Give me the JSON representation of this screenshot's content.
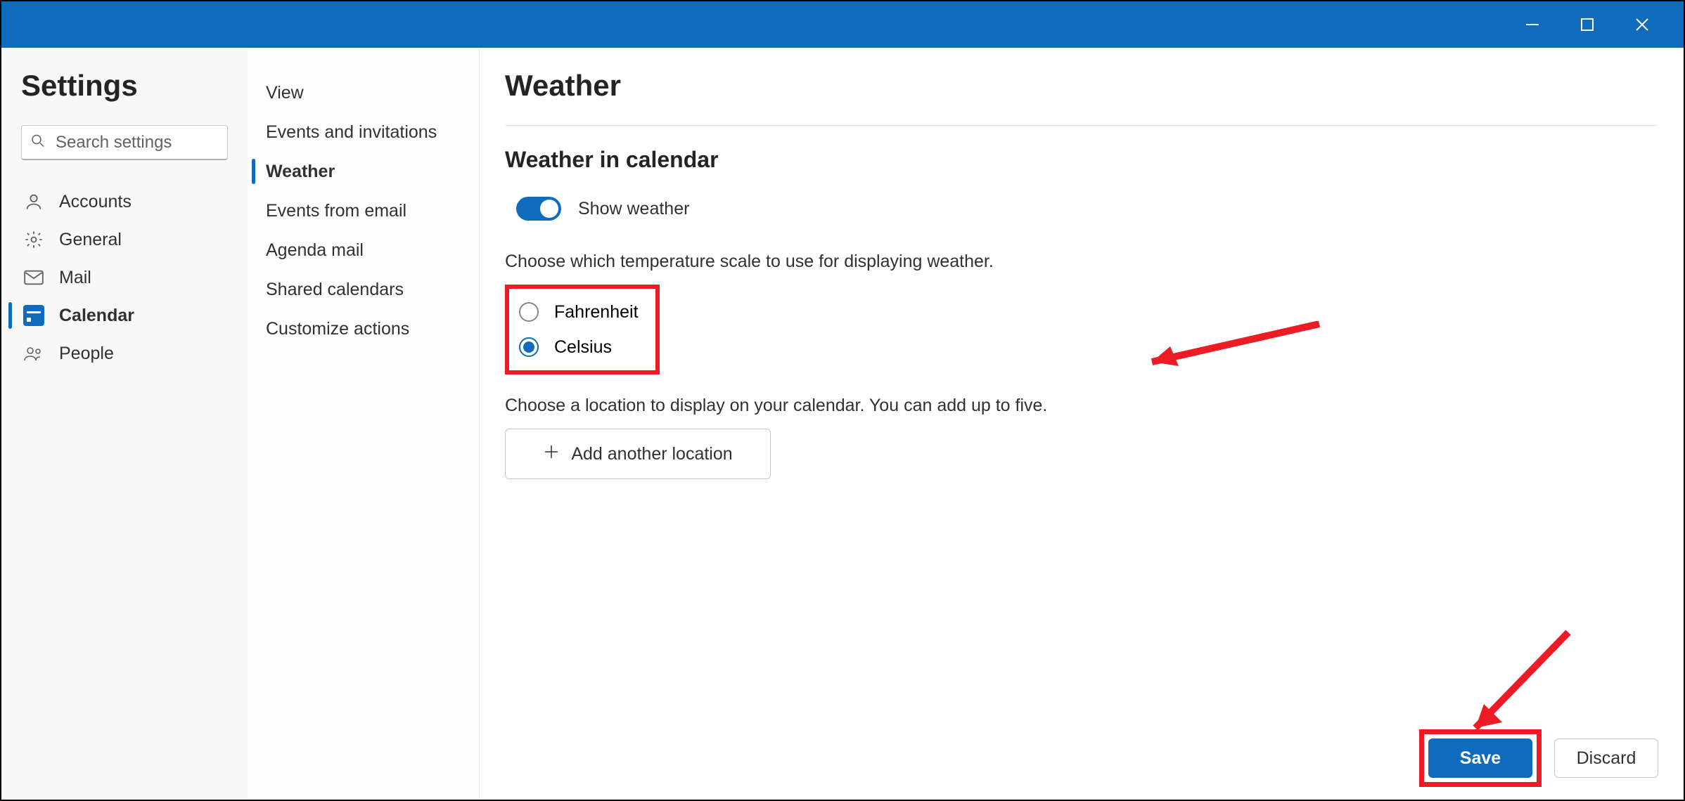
{
  "titlebar": {},
  "sidebar": {
    "heading": "Settings",
    "search_placeholder": "Search settings",
    "items": [
      {
        "label": "Accounts"
      },
      {
        "label": "General"
      },
      {
        "label": "Mail"
      },
      {
        "label": "Calendar"
      },
      {
        "label": "People"
      }
    ]
  },
  "subnav": {
    "items": [
      {
        "label": "View"
      },
      {
        "label": "Events and invitations"
      },
      {
        "label": "Weather"
      },
      {
        "label": "Events from email"
      },
      {
        "label": "Agenda mail"
      },
      {
        "label": "Shared calendars"
      },
      {
        "label": "Customize actions"
      }
    ]
  },
  "content": {
    "title": "Weather",
    "section_heading": "Weather in calendar",
    "show_weather_label": "Show weather",
    "temp_scale_prompt": "Choose which temperature scale to use for displaying weather.",
    "radio_fahrenheit": "Fahrenheit",
    "radio_celsius": "Celsius",
    "location_prompt": "Choose a location to display on your calendar. You can add up to five.",
    "add_location_label": "Add another location"
  },
  "actions": {
    "save": "Save",
    "discard": "Discard"
  }
}
